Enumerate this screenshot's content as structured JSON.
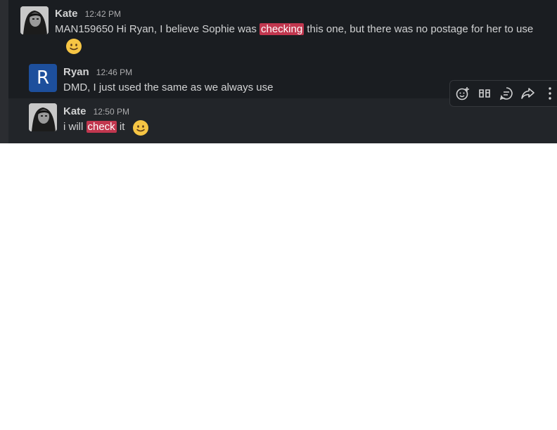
{
  "messages": [
    {
      "author": "Kate",
      "time": "12:42 PM",
      "text_before": "MAN159650 Hi Ryan, I believe Sophie was ",
      "highlight": "checking",
      "text_after": " this one, but there was no postage for her to use",
      "emoji": "slightly-smiling-face"
    },
    {
      "author": "Ryan",
      "avatar_letter": "R",
      "time": "12:46 PM",
      "text": "DMD, I just used the same as we always use"
    },
    {
      "author": "Kate",
      "time": "12:50 PM",
      "text_before": "i will ",
      "highlight": "check",
      "text_after": " it",
      "emoji": "slightly-smiling-face"
    }
  ],
  "toolbar": {
    "icons": [
      "add-reaction-icon",
      "quote-icon",
      "reply-thread-icon",
      "share-icon",
      "more-actions-icon"
    ]
  },
  "colors": {
    "background": "#1a1d21",
    "text": "#d1d2d3",
    "highlight": "#c1374f",
    "avatar_blue": "#1d4f9c"
  }
}
